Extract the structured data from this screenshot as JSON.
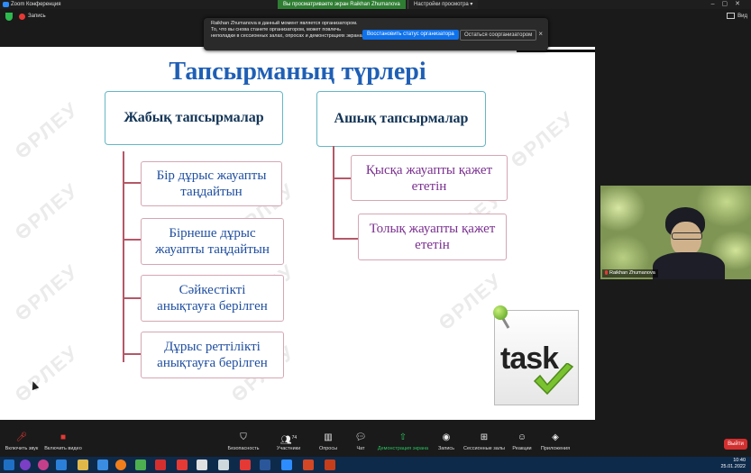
{
  "window": {
    "app_title": "Zoom Конференция",
    "viewing_banner": "Вы просматриваете экран Raikhan Zhumanova",
    "view_options": "Настройки просмотра ▾",
    "view_button": "Вид"
  },
  "recording": {
    "label": "Запись"
  },
  "notification": {
    "message": "Raikhan Zhumanova в данный момент является организатором. То, что вы снова станете организатором, может повлечь неполадки в сессионных залах, опросах и демонстрациях экрана",
    "primary_button": "Восстановить статус организатора",
    "secondary_button": "Остаться соорганизатором",
    "close": "×"
  },
  "slide": {
    "title": "Тапсырманың түрлері",
    "watermark": "ӨРЛЕУ",
    "left_category": "Жабық тапсырмалар",
    "right_category": "Ашық тапсырмалар",
    "left_items": [
      {
        "line1": "Бір дұрыс жауапты",
        "line2": "таңдайтын"
      },
      {
        "line1": "Бірнеше  дұрыс",
        "line2": "жауапты таңдайтын"
      },
      {
        "line1": "Сәйкестікті",
        "line2": "анықтауға берілген"
      },
      {
        "line1": "Дұрыс реттілікті",
        "line2": "анықтауға берілген"
      }
    ],
    "right_items": [
      {
        "line1": "Қысқа жауапты қажет",
        "line2": "ететін"
      },
      {
        "line1": "Толық жауапты қажет",
        "line2": "ететін"
      }
    ],
    "task_image_text": "task",
    "colors": {
      "title": "#1f5fb5",
      "left_items_text": "#1f4fa0",
      "right_items_text": "#7a2f8f",
      "category_border": "#66b6c6",
      "tree_line": "#b45868"
    }
  },
  "video": {
    "participant_name": "Raikhan Zhumanova"
  },
  "toolbar": {
    "mic_label": "Включить звук",
    "video_label": "Включить видео",
    "security_label": "Безопасность",
    "participants_label": "Участники",
    "participants_count": "74",
    "polls_label": "Опросы",
    "chat_label": "Чат",
    "share_label": "Демонстрация экрана",
    "record_label": "Запись",
    "breakout_label": "Сессионные залы",
    "reactions_label": "Реакции",
    "apps_label": "Приложения",
    "exit_label": "Выйти"
  },
  "taskbar": {
    "time": "10:40",
    "date": "25.01.2022"
  }
}
